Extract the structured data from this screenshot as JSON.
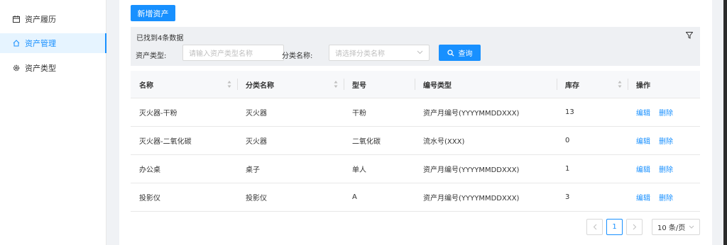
{
  "sidebar": {
    "items": [
      {
        "label": "资产履历",
        "icon": "calendar-icon",
        "active": false
      },
      {
        "label": "资产管理",
        "icon": "home-icon",
        "active": true
      },
      {
        "label": "资产类型",
        "icon": "gear-icon",
        "active": false
      }
    ]
  },
  "toolbar": {
    "add_label": "新增资产"
  },
  "search": {
    "found_text": "已找到4条数据",
    "type_label": "资产类型:",
    "type_placeholder": "请输入资产类型名称",
    "category_label": "分类名称:",
    "category_placeholder": "请选择分类名称",
    "query_label": "查询"
  },
  "table": {
    "headers": [
      "名称",
      "分类名称",
      "型号",
      "编号类型",
      "库存",
      "操作"
    ],
    "rows": [
      {
        "name": "灭火器-干粉",
        "category": "灭火器",
        "model": "干粉",
        "code_type": "资产月编号(YYYYMMDDXXX)",
        "stock": "13"
      },
      {
        "name": "灭火器-二氧化碳",
        "category": "灭火器",
        "model": "二氧化碳",
        "code_type": "流水号(XXX)",
        "stock": "0"
      },
      {
        "name": "办公桌",
        "category": "桌子",
        "model": "单人",
        "code_type": "资产月编号(YYYYMMDDXXX)",
        "stock": "1"
      },
      {
        "name": "投影仪",
        "category": "投影仪",
        "model": "A",
        "code_type": "资产月编号(YYYYMMDDXXX)",
        "stock": "3"
      }
    ],
    "edit_label": "编辑",
    "delete_label": "删除"
  },
  "pagination": {
    "current_page": "1",
    "page_size": "10 条/页"
  },
  "colors": {
    "primary": "#1890ff",
    "active_bg": "#e6f4ff"
  }
}
